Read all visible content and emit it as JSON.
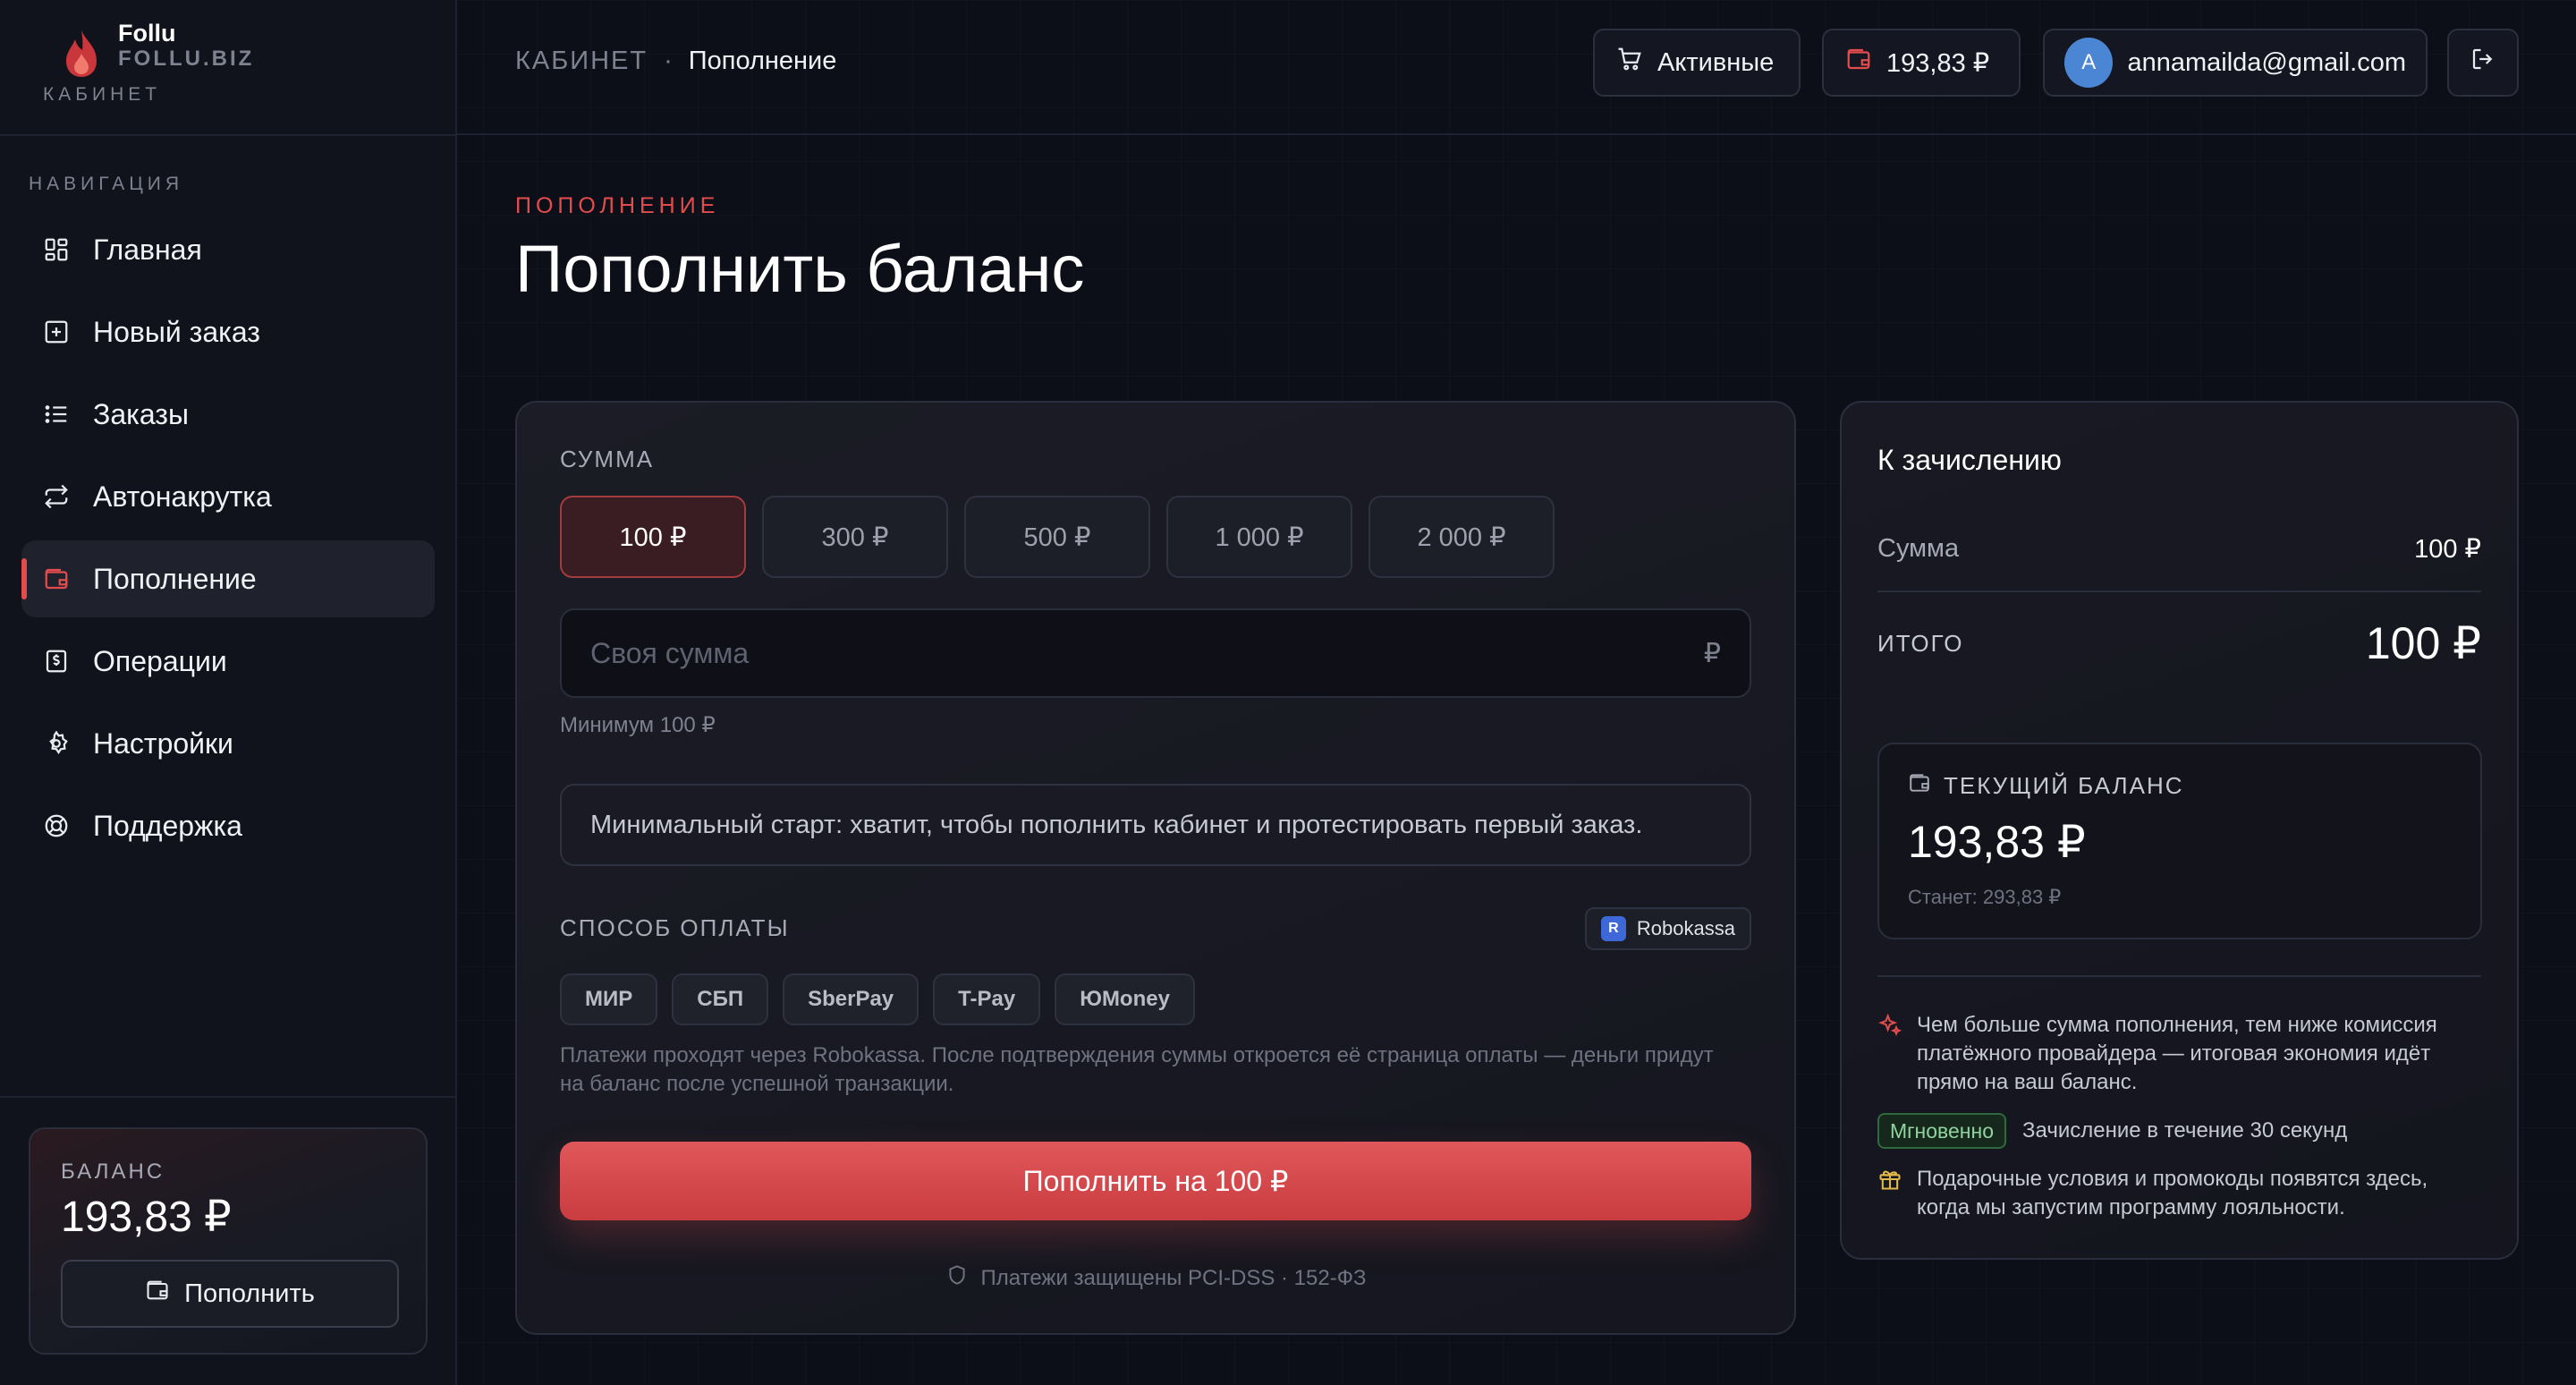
{
  "brand": {
    "name": "Follu",
    "domain": "FOLLU.BIZ",
    "section": "КАБИНЕТ"
  },
  "sidebar": {
    "nav_title": "НАВИГАЦИЯ",
    "items": [
      {
        "label": "Главная",
        "icon": "grid-icon"
      },
      {
        "label": "Новый заказ",
        "icon": "plus-square-icon"
      },
      {
        "label": "Заказы",
        "icon": "list-icon"
      },
      {
        "label": "Автонакрутка",
        "icon": "repeat-icon"
      },
      {
        "label": "Пополнение",
        "icon": "wallet-icon",
        "active": true
      },
      {
        "label": "Операции",
        "icon": "dollar-doc-icon"
      },
      {
        "label": "Настройки",
        "icon": "gear-icon"
      },
      {
        "label": "Поддержка",
        "icon": "lifebuoy-icon"
      }
    ],
    "balance": {
      "label": "БАЛАНС",
      "value": "193,83 ₽",
      "button": "Пополнить"
    }
  },
  "topbar": {
    "breadcrumb_root": "КАБИНЕТ",
    "breadcrumb_sep": "·",
    "breadcrumb_current": "Пополнение",
    "active_button": "Активные",
    "balance": "193,83 ₽",
    "avatar_letter": "A",
    "email": "annamailda@gmail.com"
  },
  "page": {
    "eyebrow": "ПОПОЛНЕНИЕ",
    "title": "Пополнить баланс"
  },
  "form": {
    "amount_label": "СУММА",
    "presets": [
      "100 ₽",
      "300 ₽",
      "500 ₽",
      "1 000 ₽",
      "2 000 ₽"
    ],
    "selected_preset": "100 ₽",
    "custom_placeholder": "Своя сумма",
    "currency_sign": "₽",
    "min_hint": "Минимум 100 ₽",
    "info": "Минимальный старт: хватит, чтобы пополнить кабинет и протестировать первый заказ.",
    "method_label": "СПОСОБ ОПЛАТЫ",
    "provider_letter": "R",
    "provider": "Robokassa",
    "methods": [
      "МИР",
      "СБП",
      "SberPay",
      "T-Pay",
      "ЮMoney"
    ],
    "note": "Платежи проходят через Robokassa. После подтверждения суммы откроется её страница оплаты — деньги придут на баланс после успешной транзакции.",
    "pay_button": "Пополнить на 100 ₽",
    "secure_note": "Платежи защищены PCI-DSS · 152-ФЗ"
  },
  "summary": {
    "title": "К зачислению",
    "sum_label": "Сумма",
    "sum_value": "100 ₽",
    "total_label": "ИТОГО",
    "total_value": "100 ₽",
    "current_label": "ТЕКУЩИЙ БАЛАНС",
    "current_value": "193,83 ₽",
    "after": "Станет: 293,83 ₽",
    "feature_1": "Чем больше сумма пополнения, тем ниже комиссия платёжного провайдера — итоговая экономия идёт прямо на ваш баланс.",
    "instant_badge": "Мгновенно",
    "instant_text": "Зачисление в течение 30 секунд",
    "feature_3": "Подарочные условия и промокоды появятся здесь, когда мы запустим программу лояльности."
  },
  "colors": {
    "accent": "#e24c4c",
    "background": "#0d0f18",
    "success": "#8fd49f"
  }
}
